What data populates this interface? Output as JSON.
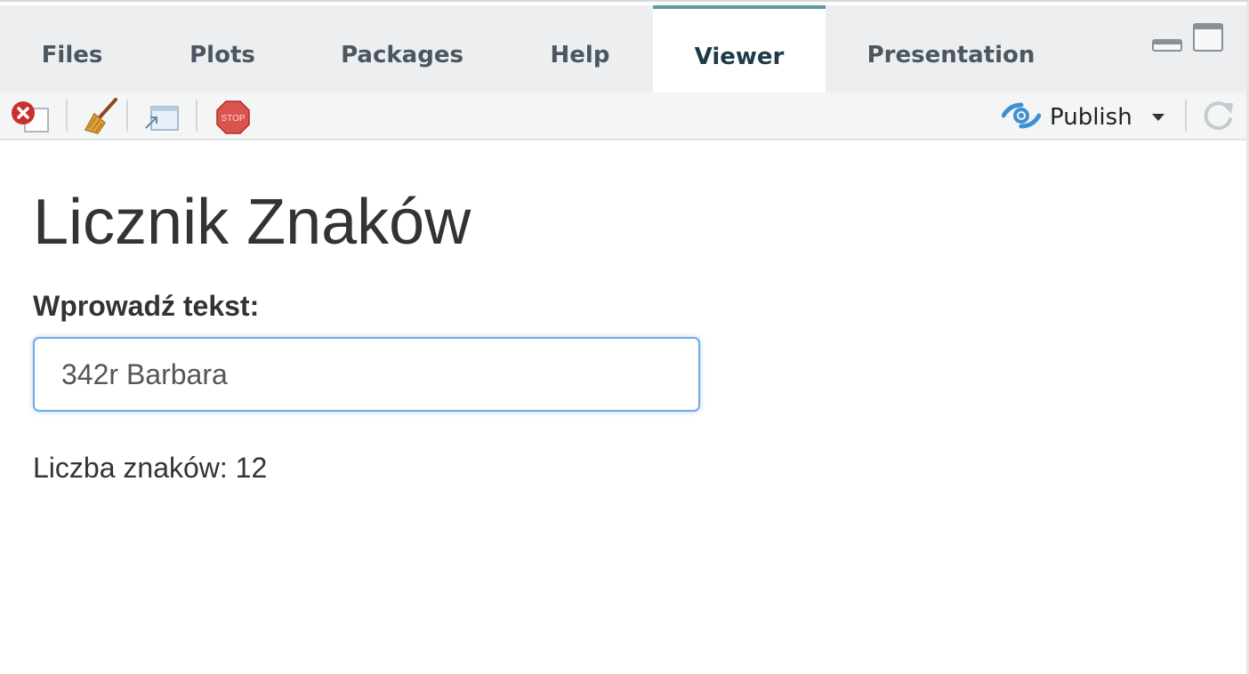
{
  "tabs": [
    {
      "label": "Files",
      "active": false
    },
    {
      "label": "Plots",
      "active": false
    },
    {
      "label": "Packages",
      "active": false
    },
    {
      "label": "Help",
      "active": false
    },
    {
      "label": "Viewer",
      "active": true
    },
    {
      "label": "Presentation",
      "active": false
    }
  ],
  "toolbar": {
    "stop_label": "STOP",
    "publish_label": "Publish",
    "icons": [
      "remove-viewer-icon",
      "broom-icon",
      "show-in-window-icon",
      "stop-icon",
      "publish-icon",
      "refresh-icon"
    ]
  },
  "app": {
    "title": "Licznik Znaków",
    "input_label": "Wprowadź tekst:",
    "input_value": "342r Barbara",
    "result_text": "Liczba znaków: 12"
  },
  "colors": {
    "active_tab_indicator": "#5b9aa0",
    "input_focus_border": "#79a9e5",
    "stop_red": "#d9534f"
  }
}
